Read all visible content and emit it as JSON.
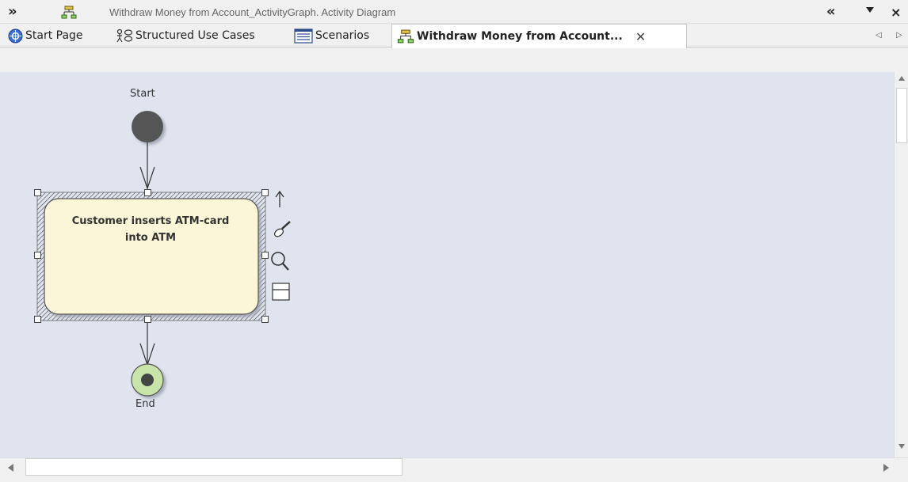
{
  "window": {
    "title": "Withdraw Money from Account_ActivityGraph.  Activity Diagram",
    "expand_icon": "double-chevron-right-icon",
    "collapse_icon": "double-chevron-left-icon",
    "dropdown_icon": "dropdown-arrow-icon",
    "close_icon": "close-icon"
  },
  "tabs": [
    {
      "label": "Start Page",
      "icon": "start-page-icon"
    },
    {
      "label": "Structured Use Cases",
      "icon": "use-case-icon"
    },
    {
      "label": "Scenarios",
      "icon": "scenario-list-icon"
    },
    {
      "label": "Withdraw Money from Account...",
      "icon": "activity-diagram-icon",
      "active": true,
      "close": "✕"
    }
  ],
  "diagram": {
    "start_node": {
      "label": "Start"
    },
    "activity": {
      "line1": "Customer inserts ATM-card",
      "line2": "into ATM"
    },
    "end_node": {
      "label": "End"
    },
    "quick_actions": [
      "quick-linker-arrow-icon",
      "paint-brush-icon",
      "zoom-magnifier-icon",
      "properties-panel-icon"
    ]
  },
  "colors": {
    "canvas": "#dfe4ef",
    "activity_fill": "#fbf6d8",
    "start_fill": "#555555",
    "end_fill": "#c9e4a8"
  }
}
